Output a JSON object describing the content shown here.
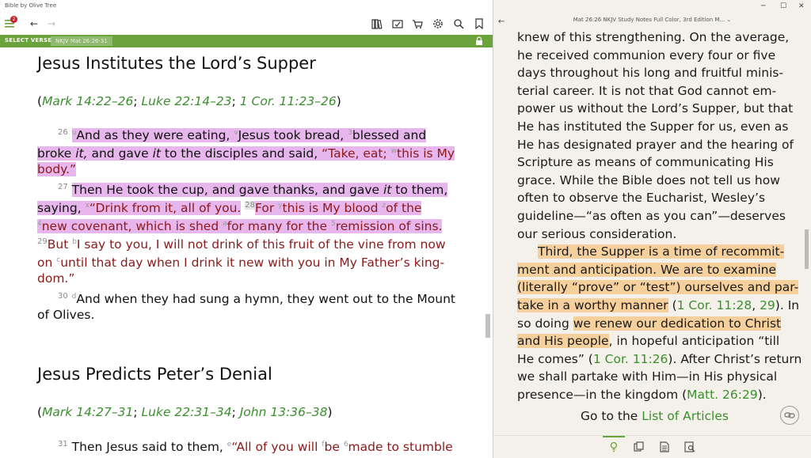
{
  "app": {
    "title": "Bible by Olive Tree",
    "badge_count": "2"
  },
  "select_bar": {
    "label": "SELECT VERSE",
    "reference": "NKJV Mat 26:26-31"
  },
  "bible": {
    "heading1": "Jesus Institutes the Lord’s Supper",
    "xref1": {
      "open": "(",
      "refs": [
        "Mark 14:22–26",
        "Luke 22:14–23",
        "1 Cor. 11:23–26"
      ],
      "sep": "; ",
      "close": ")"
    },
    "v26": {
      "num": "26",
      "fn_u": "u",
      "t1": "And as they were eating, ",
      "fn_v": "v",
      "t2": "Jesus took bread, ",
      "fn_3": "3",
      "t3": "blessed and",
      "t4": "broke ",
      "it1": "it,",
      "t5": " and gave ",
      "it2": "it",
      "t6": " to the disciples and said, ",
      "r1": "“Take, eat; ",
      "fn_w": "w",
      "r2": "this is My",
      "r3": "body.”"
    },
    "v27": {
      "num": "27",
      "t1": "Then He took the cup, and gave thanks, and gave ",
      "it1": "it",
      "t2": " to them,",
      "t3": "saying, ",
      "fn_x": "x",
      "r1": "“Drink from it, all of you.",
      "num28": "28",
      "r2": "For ",
      "fn_y": "y",
      "r3": "this is My blood ",
      "fn_z": "z",
      "r4": "of the",
      "fn_4": "4",
      "r5": "new covenant, which is shed ",
      "fn_a": "a",
      "r6": "for many for the ",
      "fn_5": "5",
      "r7": "remission of sins."
    },
    "v29": {
      "num": "29",
      "r1": "But ",
      "fn_b": "b",
      "r2": "I say to you, I will not drink of this fruit of the vine from now",
      "r3": "on ",
      "fn_c": "c",
      "r4": "until that day when I drink it new with you in My Father’s king-",
      "r5": "dom.”"
    },
    "v30": {
      "num": "30",
      "fn_d": "d",
      "t1": "And when they had sung a hymn, they went out to the Mount",
      "t2": "of Olives."
    },
    "heading2": "Jesus Predicts Peter’s Denial",
    "xref2": {
      "open": "(",
      "refs": [
        "Mark 14:27–31",
        "Luke 22:31–34",
        "John 13:36–38"
      ],
      "sep": "; ",
      "close": ")"
    },
    "v31": {
      "num": "31",
      "t1": "Then Jesus said to them, ",
      "fn_e": "e",
      "r1": "“All of you will ",
      "fn_f": "f",
      "r2": "be ",
      "fn_6": "6",
      "r3": "made to stumble"
    }
  },
  "notes_panel": {
    "title": "Mat 26:26 NKJV Study Notes Full Color, 3rd Edition M...",
    "lines": [
      "knew of this strengthening. On the average,",
      "he received communion every four or five",
      "days throughout his long and fruitful minis-",
      "terial career. It is not that God cannot em-",
      "power us without the Lord’s Supper, but that",
      "He has instituted the Supper for us, even as",
      "He has designated prayer and the hearing of",
      "Scripture as means of communicating His",
      "grace. While the Bible does not tell us how",
      "often to observe the Eucharist, Wesley’s",
      "guideline—“as often as you can”—deserves",
      "our serious consideration."
    ],
    "p2": {
      "l1": "Third, the Supper is a time of recommit-",
      "l2": "ment and anticipation. We are to examine",
      "l3": "(literally “prove” or “test”) ourselves and par-",
      "l4a": "take in a worthy manner",
      "l4b": " (",
      "l4c": "1 Cor. 11:28",
      "l4d": ", ",
      "l4e": "29",
      "l4f": "). In",
      "l5a": "so doing ",
      "l5b": "we renew our dedication to Christ",
      "l6a": "and His people",
      "l6b": ", in hopeful anticipation “till",
      "l7a": "He comes” (",
      "l7b": "1 Cor. 11:26",
      "l7c": "). After Christ’s return",
      "l8": "we shall partake with Him—in His physical",
      "l9a": "presence—in the kingdom (",
      "l9b": "Matt. 26:29",
      "l9c": ")."
    },
    "goto": {
      "prefix": "Go to the ",
      "link": "List of Articles"
    }
  },
  "colors": {
    "accent": "#6ba23c",
    "highlight_pink": "#e7b6ec",
    "highlight_orange": "#f5cf9c",
    "link_green": "#3b8f2e",
    "words_of_christ": "#8b1a1a"
  }
}
